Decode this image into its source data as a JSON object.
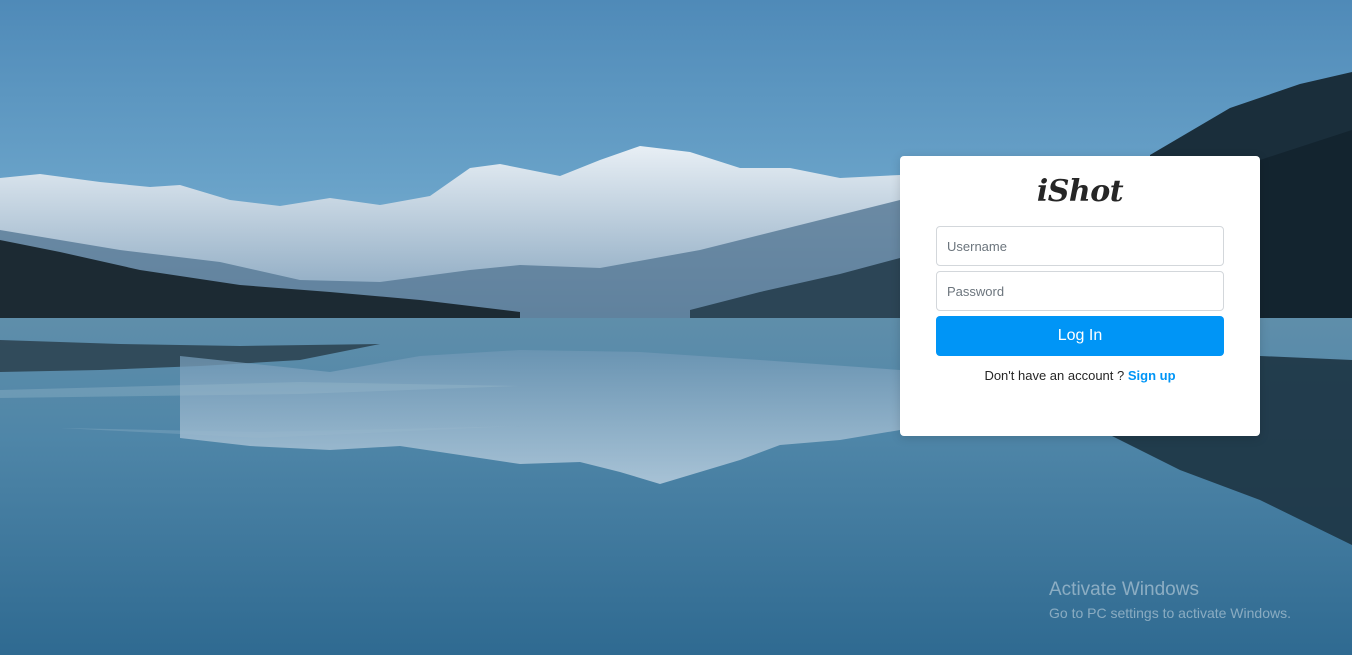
{
  "colors": {
    "accent": "#0095f6",
    "card_background": "#ffffff",
    "text": "#262626"
  },
  "background": {
    "scene": "snowy-mountain-lake-reflection"
  },
  "login": {
    "brand": "iShot",
    "username_placeholder": "Username",
    "password_placeholder": "Password",
    "login_label": "Log In",
    "signup_prompt": "Don't have an account ?",
    "signup_link": "Sign up"
  },
  "os_watermark": {
    "title": "Activate Windows",
    "subtitle": "Go to PC settings to activate Windows."
  }
}
